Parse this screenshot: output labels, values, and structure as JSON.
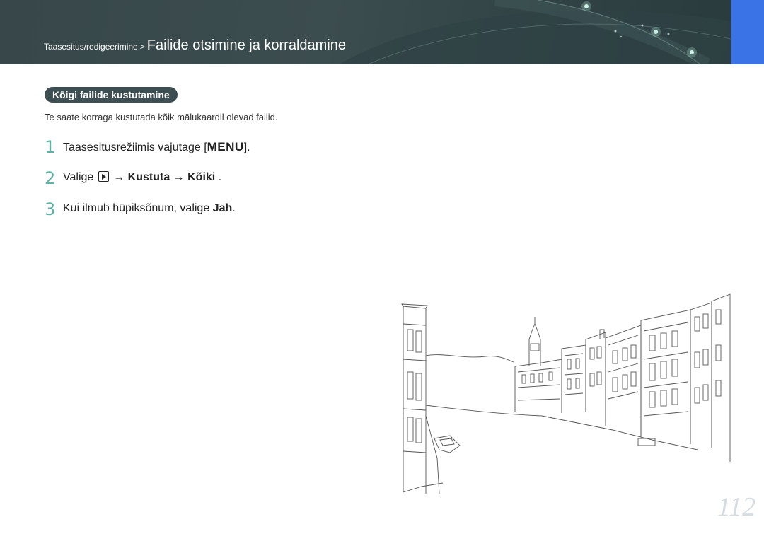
{
  "header": {
    "breadcrumb_parent": "Taasesitus/redigeerimine",
    "separator": ">",
    "title": "Failide otsimine ja korraldamine"
  },
  "section": {
    "heading": "Kõigi failide kustutamine",
    "intro": "Te saate korraga kustutada kõik mälukaardil olevad failid."
  },
  "steps": [
    {
      "number": "1",
      "pre": "Taasesitusrežiimis vajutage [",
      "key": "MENU",
      "post": "]."
    },
    {
      "number": "2",
      "pre": "Valige",
      "icon": "playback-icon",
      "arrow1": "→",
      "item1": "Kustuta",
      "arrow2": "→",
      "item2": "Kõiki",
      "post": "."
    },
    {
      "number": "3",
      "pre": "Kui ilmub hüpiksõnum, valige",
      "item": "Jah",
      "post": "."
    }
  ],
  "page_number": "112",
  "colors": {
    "header_bg": "#3c4d4f",
    "accent_blue": "#3a73e6",
    "step_number": "#5fb2a3",
    "pill_bg": "#3d4f52"
  }
}
